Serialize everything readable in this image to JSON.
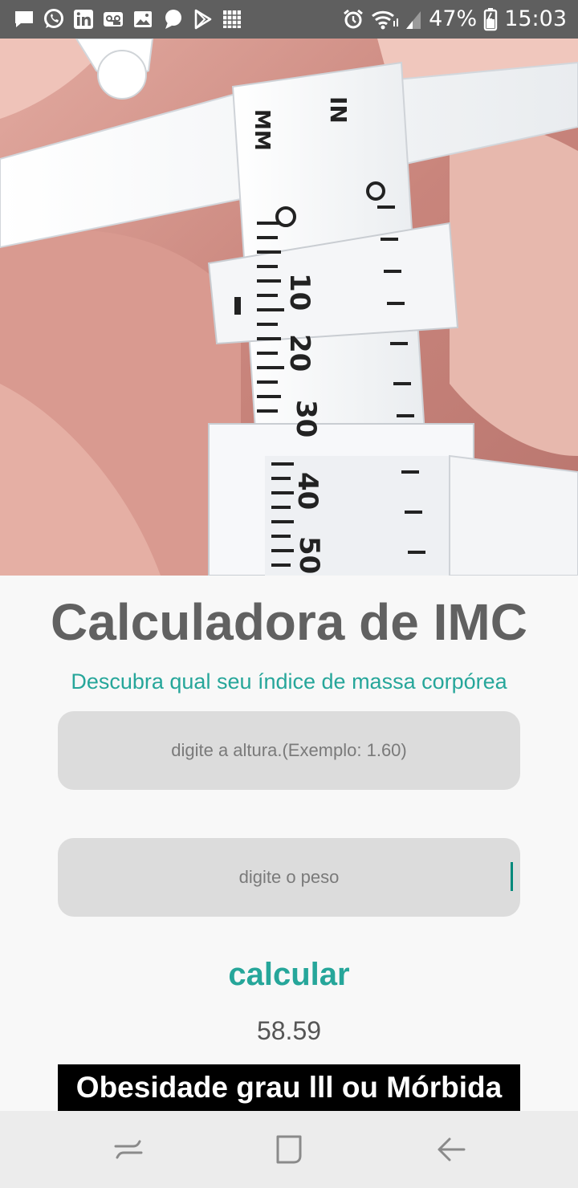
{
  "status_bar": {
    "notification_icons": [
      "message-icon",
      "whatsapp-icon",
      "linkedin-icon",
      "voicemail-icon",
      "gallery-icon",
      "chat-bubble-icon",
      "play-store-icon",
      "app-grid-icon"
    ],
    "system_icons": [
      "alarm-icon",
      "wifi-icon",
      "signal-icon"
    ],
    "battery": "47%",
    "time": "15:03"
  },
  "hero": {
    "image": "skinfold-caliper-photo",
    "caliper_text": [
      "IN",
      "MM",
      "10",
      "20",
      "30",
      "40",
      "50"
    ]
  },
  "app": {
    "title": "Calculadora de IMC",
    "subtitle": "Descubra qual seu índice de massa corpórea",
    "height_placeholder": "digite a altura.(Exemplo: 1.60)",
    "weight_placeholder": "digite o peso",
    "calculate_label": "calcular",
    "result_value": "58.59",
    "classification": "Obesidade grau lll ou Mórbida"
  },
  "nav_bar": {
    "buttons": [
      "recent-apps-icon",
      "home-icon",
      "back-icon"
    ]
  },
  "colors": {
    "accent": "#26a69a",
    "title": "#616161",
    "field_background": "#dcdcdc",
    "status_bar": "#5f5f5f",
    "classification_background": "#000000"
  }
}
